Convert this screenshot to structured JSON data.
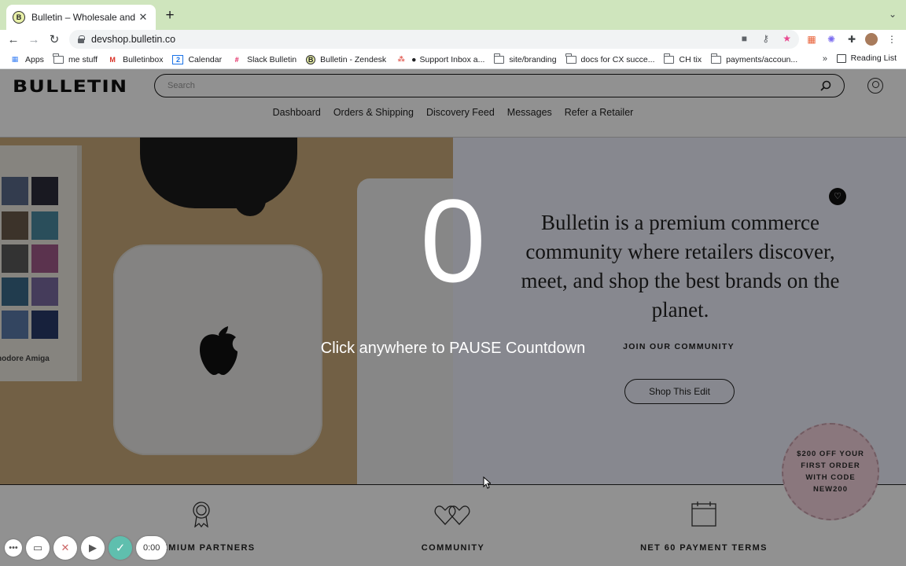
{
  "browser": {
    "tab_title": "Bulletin – Wholesale and Retail",
    "tab_favicon": "B",
    "url": "devshop.bulletin.co"
  },
  "bookmarks": [
    {
      "label": "Apps",
      "icon": "apps-grid-icon"
    },
    {
      "label": "me stuff",
      "icon": "folder-icon"
    },
    {
      "label": "Bulletinbox",
      "icon": "gmail-icon"
    },
    {
      "label": "Calendar",
      "icon": "calendar-icon"
    },
    {
      "label": "Slack Bulletin",
      "icon": "slack-icon"
    },
    {
      "label": "Bulletin - Zendesk",
      "icon": "bulletin-icon"
    },
    {
      "label": "Support Inbox a...",
      "icon": "dot-icon"
    },
    {
      "label": "site/branding",
      "icon": "folder-icon"
    },
    {
      "label": "docs for CX succe...",
      "icon": "folder-icon"
    },
    {
      "label": "CH tix",
      "icon": "folder-icon"
    },
    {
      "label": "payments/accoun...",
      "icon": "folder-icon"
    }
  ],
  "bookmarks_more": "»",
  "reading_list": "Reading List",
  "site": {
    "logo": "BULLETIN",
    "search_placeholder": "Search",
    "nav": [
      "Dashboard",
      "Orders & Shipping",
      "Discovery Feed",
      "Messages",
      "Refer a Retailer"
    ]
  },
  "hero": {
    "tagline": "Bulletin is a premium commerce community where retailers discover, meet, and shop the best brands on the planet.",
    "join": "JOIN OUR COMMUNITY",
    "cta": "Shop This Edit",
    "book_title": "nodore Amiga"
  },
  "badge": "$200 OFF YOUR FIRST ORDER WITH CODE NEW200",
  "features": [
    {
      "label": "PREMIUM PARTNERS",
      "icon": "award-ribbon-icon"
    },
    {
      "label": "COMMUNITY",
      "icon": "two-hearts-icon"
    },
    {
      "label": "NET 60 PAYMENT TERMS",
      "icon": "calendar-icon"
    }
  ],
  "countdown": {
    "number": "0",
    "hint": "Click anywhere to PAUSE Countdown"
  },
  "recorder": {
    "timer": "0:00"
  },
  "colors": {
    "tabstrip": "#cfe5bd",
    "hero_panel": "#eef0fb",
    "badge": "#f3d2dc",
    "confirm": "#5fbfae"
  }
}
